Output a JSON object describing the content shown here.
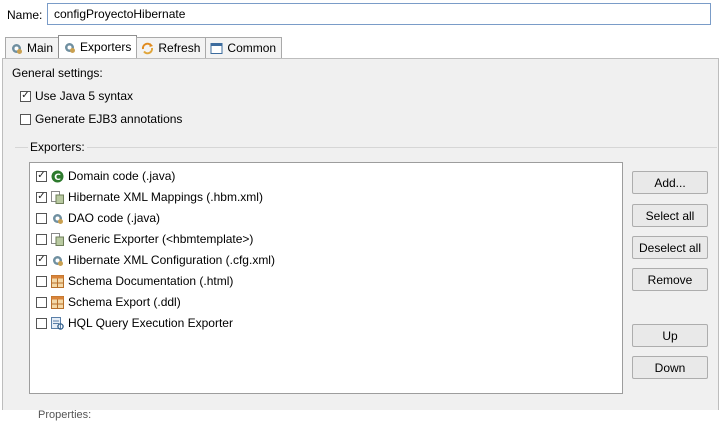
{
  "name_row": {
    "label": "Name:",
    "value": "configProyectoHibernate"
  },
  "tabs": [
    {
      "label": "Main",
      "icon": "gear-icon",
      "active": false
    },
    {
      "label": "Exporters",
      "icon": "gear-icon",
      "active": true
    },
    {
      "label": "Refresh",
      "icon": "refresh-icon",
      "active": false
    },
    {
      "label": "Common",
      "icon": "window-icon",
      "active": false
    }
  ],
  "general": {
    "label": "General settings:",
    "java5": {
      "label": "Use Java 5 syntax",
      "checked": true
    },
    "ejb3": {
      "label": "Generate EJB3 annotations",
      "checked": false
    }
  },
  "exporters": {
    "legend": "Exporters:",
    "items": [
      {
        "label": "Domain code (.java)",
        "checked": true,
        "icon": "class-icon"
      },
      {
        "label": "Hibernate XML Mappings (.hbm.xml)",
        "checked": true,
        "icon": "mapping-icon"
      },
      {
        "label": "DAO code (.java)",
        "checked": false,
        "icon": "gear-icon"
      },
      {
        "label": "Generic Exporter (<hbmtemplate>)",
        "checked": false,
        "icon": "mapping-icon"
      },
      {
        "label": "Hibernate XML Configuration (.cfg.xml)",
        "checked": true,
        "icon": "gear-icon"
      },
      {
        "label": "Schema Documentation (.html)",
        "checked": false,
        "icon": "schema-icon"
      },
      {
        "label": "Schema Export (.ddl)",
        "checked": false,
        "icon": "schema-icon"
      },
      {
        "label": "HQL Query Execution Exporter",
        "checked": false,
        "icon": "query-icon"
      }
    ]
  },
  "buttons": {
    "add": "Add...",
    "select_all": "Select all",
    "deselect_all": "Deselect all",
    "remove": "Remove",
    "up": "Up",
    "down": "Down"
  },
  "properties_label": "Properties:",
  "check_glyph": "✓",
  "colors": {
    "accent": "#2d7a2d",
    "tab_active_border": "#8f8f8f"
  }
}
